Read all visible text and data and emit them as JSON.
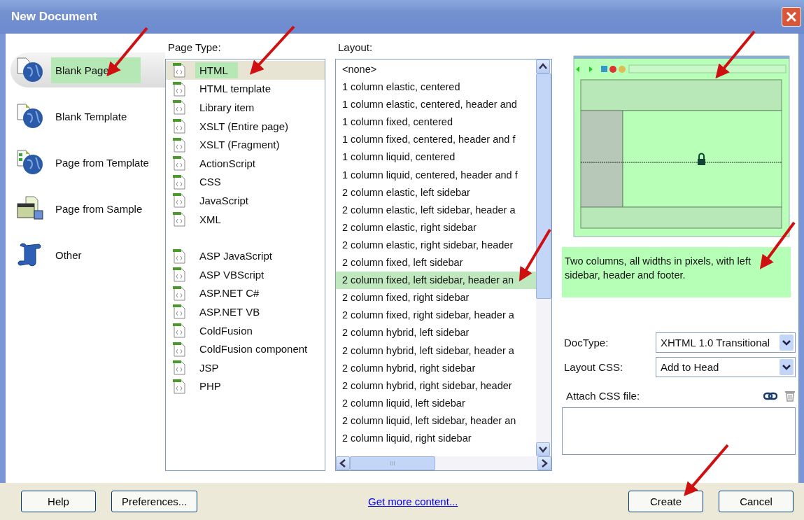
{
  "window": {
    "title": "New Document"
  },
  "categories": [
    {
      "label": "Blank Page",
      "kind": "blank-page",
      "selected": true,
      "highlighted": true
    },
    {
      "label": "Blank Template",
      "kind": "blank-template",
      "selected": false,
      "highlighted": false
    },
    {
      "label": "Page from Template",
      "kind": "page-from-template",
      "selected": false,
      "highlighted": false
    },
    {
      "label": "Page from Sample",
      "kind": "page-from-sample",
      "selected": false,
      "highlighted": false
    },
    {
      "label": "Other",
      "kind": "other",
      "selected": false,
      "highlighted": false
    }
  ],
  "page_type": {
    "label": "Page Type:",
    "groups": [
      [
        {
          "label": "HTML",
          "selected": true,
          "highlighted": true
        },
        {
          "label": "HTML template",
          "selected": false,
          "highlighted": false
        },
        {
          "label": "Library item",
          "selected": false,
          "highlighted": false
        },
        {
          "label": "XSLT (Entire page)",
          "selected": false,
          "highlighted": false
        },
        {
          "label": "XSLT (Fragment)",
          "selected": false,
          "highlighted": false
        },
        {
          "label": "ActionScript",
          "selected": false,
          "highlighted": false
        },
        {
          "label": "CSS",
          "selected": false,
          "highlighted": false
        },
        {
          "label": "JavaScript",
          "selected": false,
          "highlighted": false
        },
        {
          "label": "XML",
          "selected": false,
          "highlighted": false
        }
      ],
      [
        {
          "label": "ASP JavaScript",
          "selected": false,
          "highlighted": false
        },
        {
          "label": "ASP VBScript",
          "selected": false,
          "highlighted": false
        },
        {
          "label": "ASP.NET C#",
          "selected": false,
          "highlighted": false
        },
        {
          "label": "ASP.NET VB",
          "selected": false,
          "highlighted": false
        },
        {
          "label": "ColdFusion",
          "selected": false,
          "highlighted": false
        },
        {
          "label": "ColdFusion component",
          "selected": false,
          "highlighted": false
        },
        {
          "label": "JSP",
          "selected": false,
          "highlighted": false
        },
        {
          "label": "PHP",
          "selected": false,
          "highlighted": false
        }
      ]
    ]
  },
  "layout": {
    "label": "Layout:",
    "items": [
      {
        "label": "<none>",
        "selected": false
      },
      {
        "label": "1 column elastic, centered",
        "selected": false
      },
      {
        "label": "1 column elastic, centered, header and",
        "selected": false
      },
      {
        "label": "1 column fixed, centered",
        "selected": false
      },
      {
        "label": "1 column fixed, centered, header and f",
        "selected": false
      },
      {
        "label": "1 column liquid, centered",
        "selected": false
      },
      {
        "label": "1 column liquid, centered, header and f",
        "selected": false
      },
      {
        "label": "2 column elastic, left sidebar",
        "selected": false
      },
      {
        "label": "2 column elastic, left sidebar, header a",
        "selected": false
      },
      {
        "label": "2 column elastic, right sidebar",
        "selected": false
      },
      {
        "label": "2 column elastic, right sidebar, header",
        "selected": false
      },
      {
        "label": "2 column fixed, left sidebar",
        "selected": false
      },
      {
        "label": "2 column fixed, left sidebar, header an",
        "selected": true
      },
      {
        "label": "2 column fixed, right sidebar",
        "selected": false
      },
      {
        "label": "2 column fixed, right sidebar, header a",
        "selected": false
      },
      {
        "label": "2 column hybrid, left sidebar",
        "selected": false
      },
      {
        "label": "2 column hybrid, left sidebar, header a",
        "selected": false
      },
      {
        "label": "2 column hybrid, right sidebar",
        "selected": false
      },
      {
        "label": "2 column hybrid, right sidebar, header",
        "selected": false
      },
      {
        "label": "2 column liquid, left sidebar",
        "selected": false
      },
      {
        "label": "2 column liquid, left sidebar, header an",
        "selected": false
      },
      {
        "label": "2 column liquid, right sidebar",
        "selected": false
      }
    ],
    "scroll_grip": "III"
  },
  "description": "Two columns, all widths in pixels, with left sidebar, header and footer.",
  "doctype": {
    "label": "DocType:",
    "value": "XHTML 1.0 Transitional"
  },
  "layout_css": {
    "label": "Layout CSS:",
    "value": "Add to Head"
  },
  "attach_css": {
    "label": "Attach CSS file:"
  },
  "buttons_left": [
    "Help",
    "Preferences..."
  ],
  "link": "Get more content...",
  "buttons_right": [
    "Create",
    "Cancel"
  ]
}
